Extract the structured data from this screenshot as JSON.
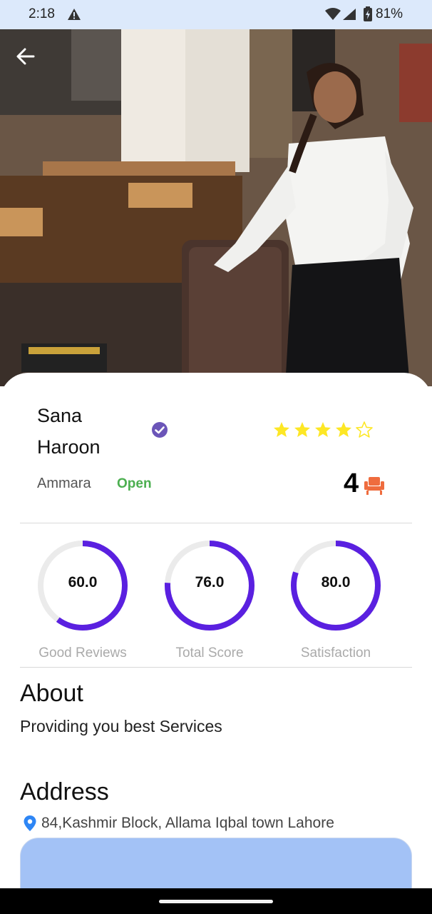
{
  "status_bar": {
    "time": "2:18",
    "battery": "81%"
  },
  "header": {
    "back_icon": "arrow-left-icon"
  },
  "profile": {
    "name": "Sana Haroon",
    "verified_icon": "verified-check-icon",
    "rating": 4,
    "rating_max": 5,
    "salon": "Ammara",
    "status": "Open",
    "seats": "4",
    "seat_icon": "barber-chair-icon"
  },
  "stats": [
    {
      "value": "60.0",
      "label": "Good Reviews",
      "percent": 60
    },
    {
      "value": "76.0",
      "label": "Total Score",
      "percent": 76
    },
    {
      "value": "80.0",
      "label": "Satisfaction",
      "percent": 80
    }
  ],
  "about": {
    "title": "About",
    "text": "Providing you best Services"
  },
  "address": {
    "title": "Address",
    "icon": "location-pin-icon",
    "text": "84,Kashmir Block, Allama Iqbal town Lahore"
  },
  "colors": {
    "accent": "#5a20e0",
    "track": "#ebebeb",
    "open": "#4caf50",
    "star": "#fde725",
    "seat": "#ef6c3e",
    "verified": "#6b55b8",
    "map": "#a3c2f6",
    "pin": "#2e86f5"
  }
}
